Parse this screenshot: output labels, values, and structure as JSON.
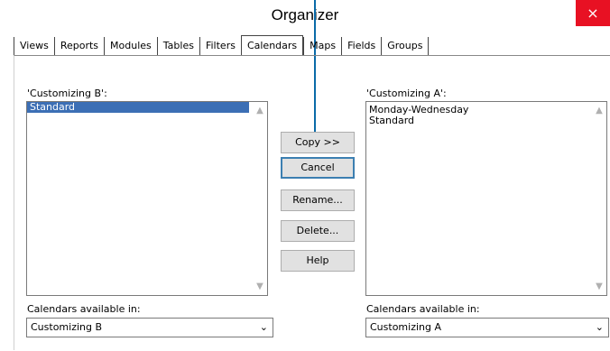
{
  "window": {
    "title": "Organizer",
    "close_label": "×"
  },
  "tabs": [
    {
      "label": "Views"
    },
    {
      "label": "Reports"
    },
    {
      "label": "Modules"
    },
    {
      "label": "Tables"
    },
    {
      "label": "Filters"
    },
    {
      "label": "Calendars",
      "active": true
    },
    {
      "label": "Maps"
    },
    {
      "label": "Fields"
    },
    {
      "label": "Groups"
    }
  ],
  "left_panel": {
    "caption": "'Customizing B':",
    "items": [
      "Standard"
    ],
    "selected_index": 0,
    "available_label": "Calendars available in:",
    "available_value": "Customizing B"
  },
  "right_panel": {
    "caption": "'Customizing A':",
    "items": [
      "Monday-Wednesday",
      "Standard"
    ],
    "available_label": "Calendars available in:",
    "available_value": "Customizing A"
  },
  "buttons": {
    "copy": "Copy >>",
    "cancel": "Cancel",
    "rename": "Rename...",
    "delete": "Delete...",
    "help": "Help"
  },
  "icons": {
    "close": "close-icon",
    "scroll_up": "scroll-up-icon",
    "scroll_down": "scroll-down-icon",
    "dropdown": "chevron-down-icon"
  },
  "colors": {
    "selection": "#3c6fb5",
    "close": "#e81123",
    "callout": "#0a6aa8"
  }
}
